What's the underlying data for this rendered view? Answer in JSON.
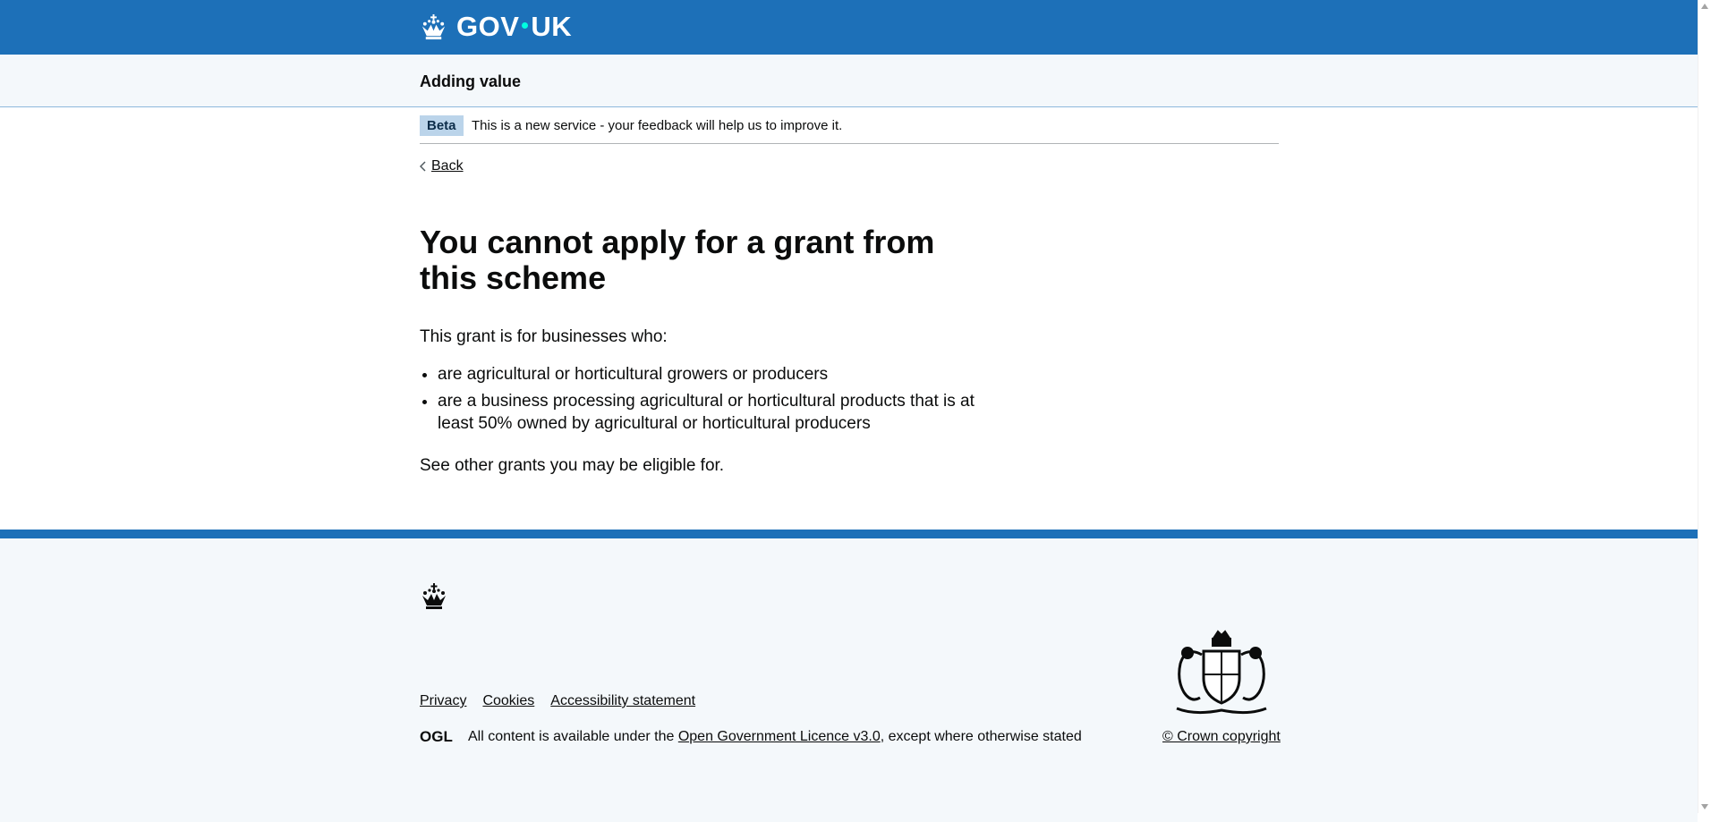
{
  "header": {
    "logo_text_left": "GOV",
    "logo_text_right": "UK"
  },
  "service": {
    "name": "Adding value"
  },
  "phase_banner": {
    "tag": "Beta",
    "text": "This is a new service - your feedback will help us to improve it."
  },
  "back_link": "Back",
  "main": {
    "heading": "You cannot apply for a grant from this scheme",
    "intro": "This grant is for businesses who:",
    "criteria": [
      "are agricultural or horticultural growers or producers",
      "are a business processing agricultural or horticultural products that is at least 50% owned by agricultural or horticultural producers"
    ],
    "other": "See other grants you may be eligible for."
  },
  "footer": {
    "links": [
      "Privacy",
      "Cookies",
      "Accessibility statement"
    ],
    "licence_prefix": "All content is available under the",
    "licence_link": "Open Government Licence v3.0",
    "licence_suffix": ", except where otherwise stated",
    "copyright": "© Crown copyright",
    "ogl_logo_text": "OGL"
  },
  "colors": {
    "brand_blue": "#1d70b8",
    "footer_bg": "#f4f8fb",
    "phase_tag_bg": "#bbd4ea",
    "text": "#0b0c0c"
  },
  "icons": [
    "crown-icon",
    "chevron-left-icon",
    "ogl-logo-icon",
    "royal-coat-of-arms-icon"
  ]
}
